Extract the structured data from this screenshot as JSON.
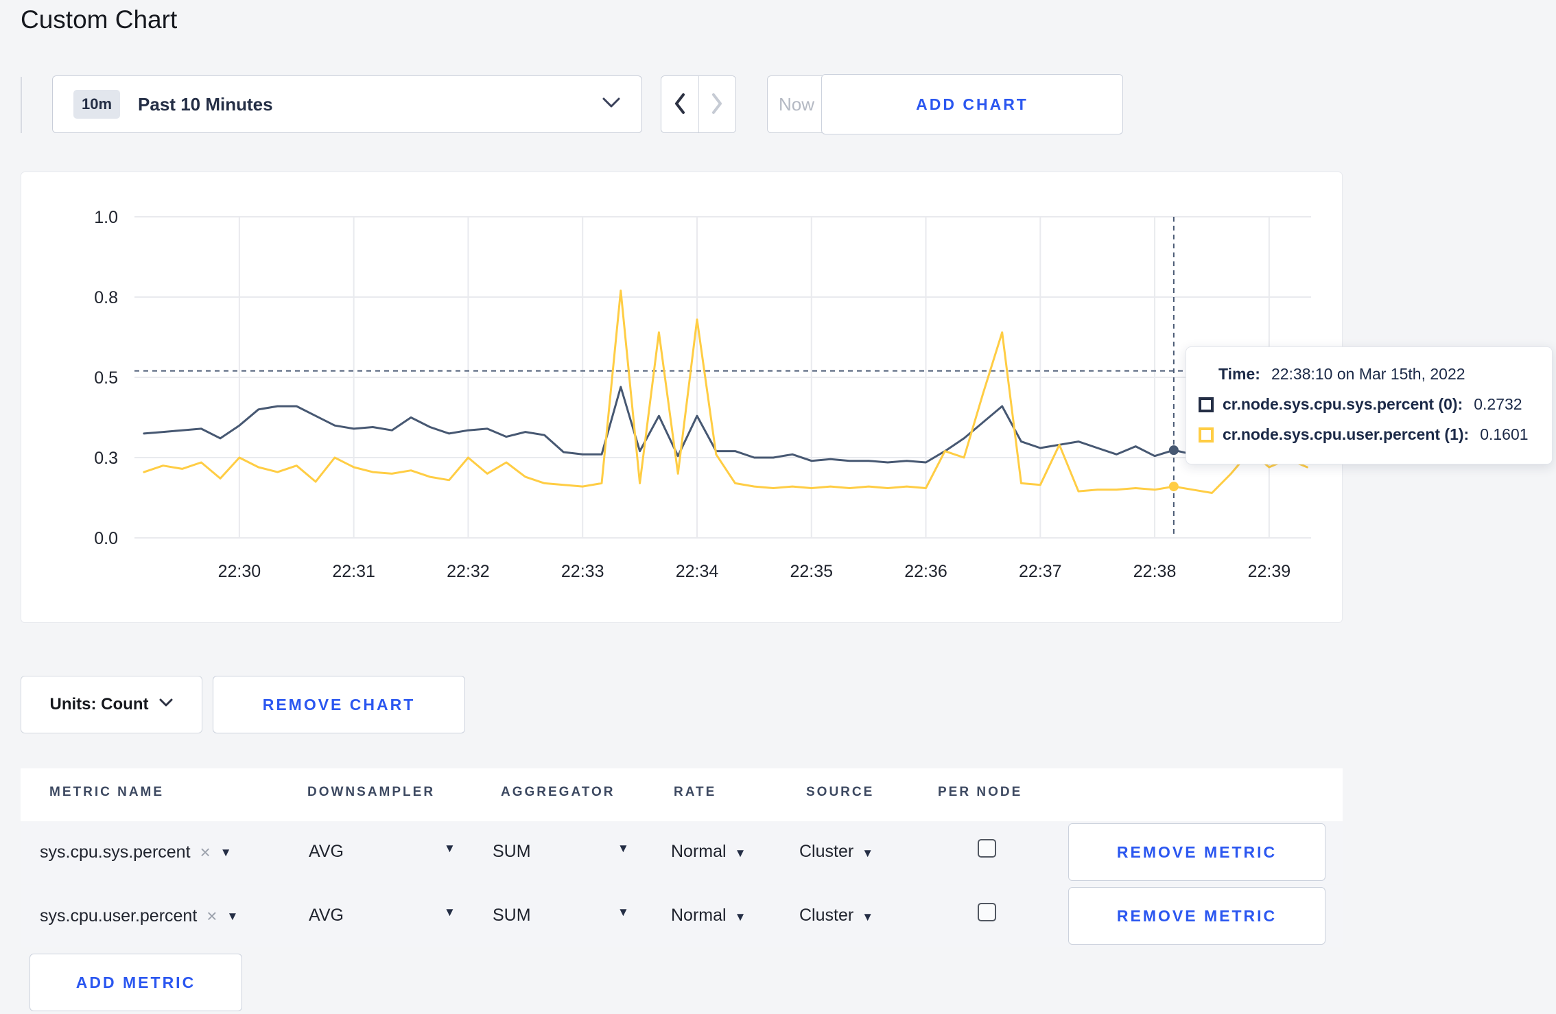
{
  "page": {
    "title": "Custom Chart"
  },
  "toolbar": {
    "time_window_badge": "10m",
    "time_window_label": "Past 10 Minutes",
    "now_label": "Now",
    "add_chart_label": "ADD CHART"
  },
  "colors": {
    "accent_blue": "#2b57f0",
    "series_sys": "#475872",
    "series_user": "#ffcd44",
    "crosshair": "#4a5a75",
    "gridline": "#e9eaee"
  },
  "chart_data": {
    "type": "line",
    "title": "",
    "xlabel": "",
    "ylabel": "",
    "ylim": [
      0,
      1
    ],
    "grid": true,
    "legend_position": "tooltip",
    "y_ticks": [
      {
        "label": "1.0",
        "value": 1.0
      },
      {
        "label": "0.8",
        "value": 0.75
      },
      {
        "label": "0.5",
        "value": 0.5
      },
      {
        "label": "0.3",
        "value": 0.25
      },
      {
        "label": "0.0",
        "value": 0.0
      }
    ],
    "x_ticks": [
      "22:30",
      "22:31",
      "22:32",
      "22:33",
      "22:34",
      "22:35",
      "22:36",
      "22:37",
      "22:38",
      "22:39"
    ],
    "x_domain": [
      "22:29:05",
      "22:39:22"
    ],
    "x_start": "22:29:10",
    "x_interval_seconds": 10,
    "series": [
      {
        "name": "cr.node.sys.cpu.sys.percent",
        "color": "#475872",
        "values": [
          0.325,
          0.33,
          0.335,
          0.34,
          0.31,
          0.35,
          0.4,
          0.41,
          0.41,
          0.38,
          0.35,
          0.34,
          0.345,
          0.335,
          0.375,
          0.345,
          0.325,
          0.335,
          0.34,
          0.315,
          0.33,
          0.32,
          0.267,
          0.26,
          0.26,
          0.47,
          0.27,
          0.38,
          0.255,
          0.38,
          0.27,
          0.27,
          0.25,
          0.25,
          0.26,
          0.24,
          0.245,
          0.24,
          0.24,
          0.235,
          0.24,
          0.235,
          0.27,
          0.31,
          0.36,
          0.41,
          0.3,
          0.28,
          0.29,
          0.3,
          0.28,
          0.26,
          0.285,
          0.255,
          0.2732,
          0.26,
          0.27,
          0.29,
          0.27,
          0.29,
          0.3,
          0.295
        ]
      },
      {
        "name": "cr.node.sys.cpu.user.percent",
        "color": "#ffcd44",
        "values": [
          0.205,
          0.225,
          0.215,
          0.235,
          0.185,
          0.25,
          0.22,
          0.205,
          0.225,
          0.175,
          0.25,
          0.22,
          0.205,
          0.2,
          0.21,
          0.19,
          0.18,
          0.25,
          0.2,
          0.235,
          0.19,
          0.17,
          0.165,
          0.16,
          0.17,
          0.77,
          0.17,
          0.64,
          0.2,
          0.68,
          0.26,
          0.17,
          0.16,
          0.155,
          0.16,
          0.155,
          0.16,
          0.155,
          0.16,
          0.155,
          0.16,
          0.155,
          0.27,
          0.25,
          0.45,
          0.64,
          0.17,
          0.165,
          0.29,
          0.145,
          0.15,
          0.15,
          0.155,
          0.15,
          0.1601,
          0.15,
          0.14,
          0.2,
          0.27,
          0.22,
          0.245,
          0.22
        ]
      }
    ]
  },
  "tooltip": {
    "time_label": "Time:",
    "time_value": "22:38:10 on Mar 15th, 2022",
    "crosshair": {
      "time": "22:38:10",
      "value_line": 0.52
    },
    "entries": [
      {
        "label": "cr.node.sys.cpu.sys.percent (0):",
        "value": "0.2732",
        "swatch_color": "#242e45"
      },
      {
        "label": "cr.node.sys.cpu.user.percent (1):",
        "value": "0.1601",
        "swatch_color": "#ffcd44"
      }
    ]
  },
  "units_bar": {
    "units_label": "Units: Count",
    "remove_chart_label": "REMOVE CHART"
  },
  "metrics_table": {
    "headers": [
      "METRIC NAME",
      "DOWNSAMPLER",
      "AGGREGATOR",
      "RATE",
      "SOURCE",
      "PER NODE"
    ],
    "rows": [
      {
        "metric": "sys.cpu.sys.percent",
        "downsampler": "AVG",
        "aggregator": "SUM",
        "rate": "Normal",
        "source": "Cluster",
        "per_node_checked": false,
        "remove_label": "REMOVE METRIC"
      },
      {
        "metric": "sys.cpu.user.percent",
        "downsampler": "AVG",
        "aggregator": "SUM",
        "rate": "Normal",
        "source": "Cluster",
        "per_node_checked": false,
        "remove_label": "REMOVE METRIC"
      }
    ],
    "add_metric_label": "ADD METRIC"
  }
}
